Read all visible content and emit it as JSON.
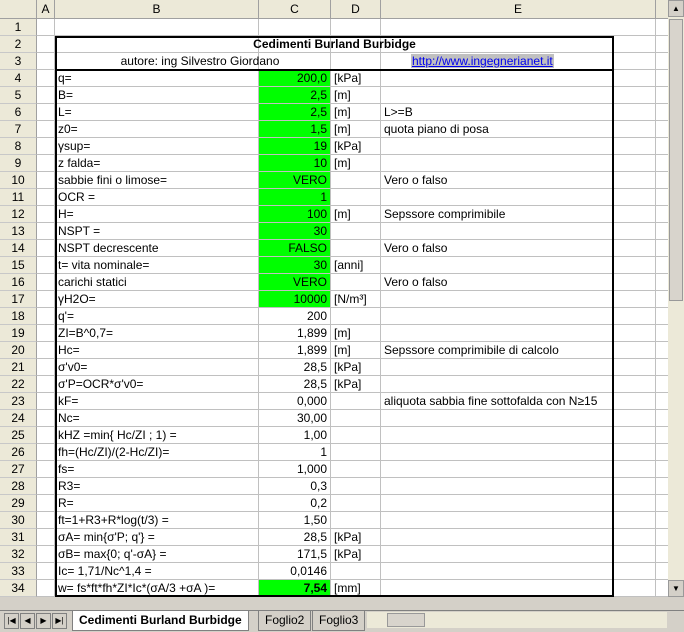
{
  "columns": [
    "A",
    "B",
    "C",
    "D",
    "E"
  ],
  "header": {
    "title": "Cedimenti Burland Burbidge",
    "author": "autore: ing Silvestro Giordano",
    "link": "http://www.ingegnerianet.it"
  },
  "rows": [
    {
      "n": "1"
    },
    {
      "n": "2"
    },
    {
      "n": "3"
    },
    {
      "n": "4",
      "b": "q=",
      "c": "200,0",
      "d": "[kPa]",
      "e": "",
      "green": true
    },
    {
      "n": "5",
      "b": "B=",
      "c": "2,5",
      "d": "[m]",
      "e": "",
      "green": true
    },
    {
      "n": "6",
      "b": "L=",
      "c": "2,5",
      "d": "[m]",
      "e": "L>=B",
      "green": true
    },
    {
      "n": "7",
      "b": "z0=",
      "c": "1,5",
      "d": "[m]",
      "e": "quota piano di posa",
      "green": true
    },
    {
      "n": "8",
      "b": "γsup=",
      "c": "19",
      "d": "[kPa]",
      "e": "",
      "green": true
    },
    {
      "n": "9",
      "b": "z falda=",
      "c": "10",
      "d": "[m]",
      "e": "",
      "green": true
    },
    {
      "n": "10",
      "b": "sabbie fini o limose=",
      "c": "VERO",
      "d": "",
      "e": "Vero o falso",
      "green": true
    },
    {
      "n": "11",
      "b": "OCR =",
      "c": "1",
      "d": "",
      "e": "",
      "green": true
    },
    {
      "n": "12",
      "b": "H=",
      "c": "100",
      "d": "[m]",
      "e": "Sepssore comprimibile",
      "green": true
    },
    {
      "n": "13",
      "b": "NSPT =",
      "c": "30",
      "d": "",
      "e": "",
      "green": true
    },
    {
      "n": "14",
      "b": "NSPT decrescente",
      "c": "FALSO",
      "d": "",
      "e": "Vero o falso",
      "green": true
    },
    {
      "n": "15",
      "b": "t= vita nominale=",
      "c": "30",
      "d": "[anni]",
      "e": "",
      "green": true
    },
    {
      "n": "16",
      "b": "carichi statici",
      "c": "VERO",
      "d": "",
      "e": "Vero o falso",
      "green": true
    },
    {
      "n": "17",
      "b": "γH2O=",
      "c": "10000",
      "d": "[N/m³]",
      "e": "",
      "green": true
    },
    {
      "n": "18",
      "b": "q'=",
      "c": "200",
      "d": "",
      "e": ""
    },
    {
      "n": "19",
      "b": "ZI=B^0,7=",
      "c": "1,899",
      "d": "[m]",
      "e": ""
    },
    {
      "n": "20",
      "b": "Hc=",
      "c": "1,899",
      "d": "[m]",
      "e": "Sepssore comprimibile di calcolo"
    },
    {
      "n": "21",
      "b": "σ'v0=",
      "c": "28,5",
      "d": "[kPa]",
      "e": ""
    },
    {
      "n": "22",
      "b": "σ'P=OCR*σ'v0=",
      "c": "28,5",
      "d": "[kPa]",
      "e": ""
    },
    {
      "n": "23",
      "b": "kF=",
      "c": "0,000",
      "d": "",
      "e": "aliquota sabbia fine sottofalda con N≥15"
    },
    {
      "n": "24",
      "b": "Nc=",
      "c": "30,00",
      "d": "",
      "e": ""
    },
    {
      "n": "25",
      "b": "kHZ =min{ Hc/ZI ; 1) =",
      "c": "1,00",
      "d": "",
      "e": ""
    },
    {
      "n": "26",
      "b": "fh=(Hc/ZI)/(2-Hc/ZI)=",
      "c": "1",
      "d": "",
      "e": ""
    },
    {
      "n": "27",
      "b": "fs=",
      "c": "1,000",
      "d": "",
      "e": ""
    },
    {
      "n": "28",
      "b": "R3=",
      "c": "0,3",
      "d": "",
      "e": ""
    },
    {
      "n": "29",
      "b": "R=",
      "c": "0,2",
      "d": "",
      "e": ""
    },
    {
      "n": "30",
      "b": "ft=1+R3+R*log(t/3) =",
      "c": "1,50",
      "d": "",
      "e": ""
    },
    {
      "n": "31",
      "b": "σA= min{σ'P; q'} =",
      "c": "28,5",
      "d": "[kPa]",
      "e": ""
    },
    {
      "n": "32",
      "b": "σB= max{0; q'-σA} =",
      "c": "171,5",
      "d": "[kPa]",
      "e": ""
    },
    {
      "n": "33",
      "b": "Ic= 1,71/Nc^1,4 =",
      "c": "0,0146",
      "d": "",
      "e": ""
    },
    {
      "n": "34",
      "b": "w= fs*ft*fh*ZI*Ic*(σA/3 +σA )=",
      "c": "7,54",
      "d": "[mm]",
      "e": "",
      "green": true,
      "bold": true
    }
  ],
  "tabs": [
    "Cedimenti Burland Burbidge",
    "Foglio2",
    "Foglio3"
  ],
  "colors": {
    "input": "#00ff00",
    "header_bg": "#ece9d8",
    "link": "#0000ee"
  }
}
